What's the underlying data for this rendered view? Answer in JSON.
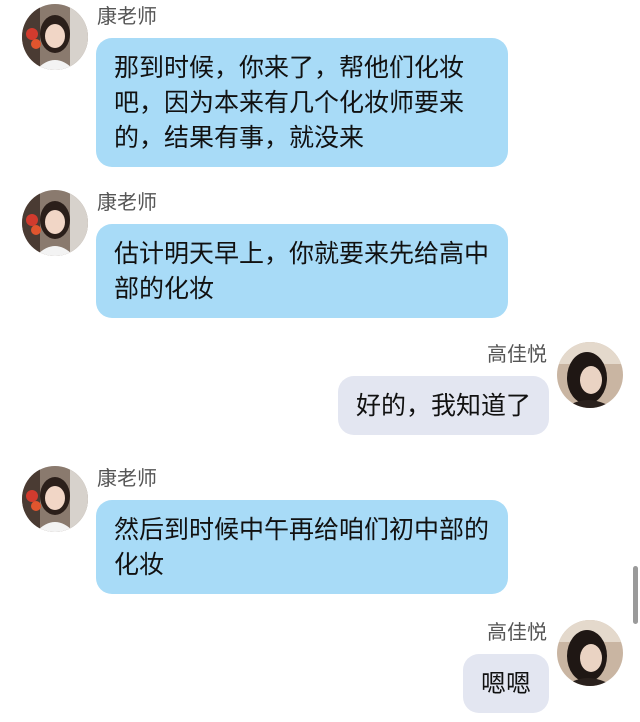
{
  "messages": [
    {
      "side": "in",
      "sender": "康老师",
      "text": "那到时候，你来了，帮他们化妆吧，因为本来有几个化妆师要来的，结果有事，就没来"
    },
    {
      "side": "in",
      "sender": "康老师",
      "text": "估计明天早上，你就要来先给高中部的化妆"
    },
    {
      "side": "out",
      "sender": "高佳悦",
      "text": "好的，我知道了"
    },
    {
      "side": "in",
      "sender": "康老师",
      "text": "然后到时候中午再给咱们初中部的化妆"
    },
    {
      "side": "out",
      "sender": "高佳悦",
      "text": "嗯嗯"
    }
  ],
  "colors": {
    "incoming_bubble": "#a8dbf7",
    "outgoing_bubble": "#e3e6f1"
  },
  "icons": {
    "teacher_avatar": "teacher-avatar-photo",
    "user_avatar": "user-avatar-photo"
  }
}
